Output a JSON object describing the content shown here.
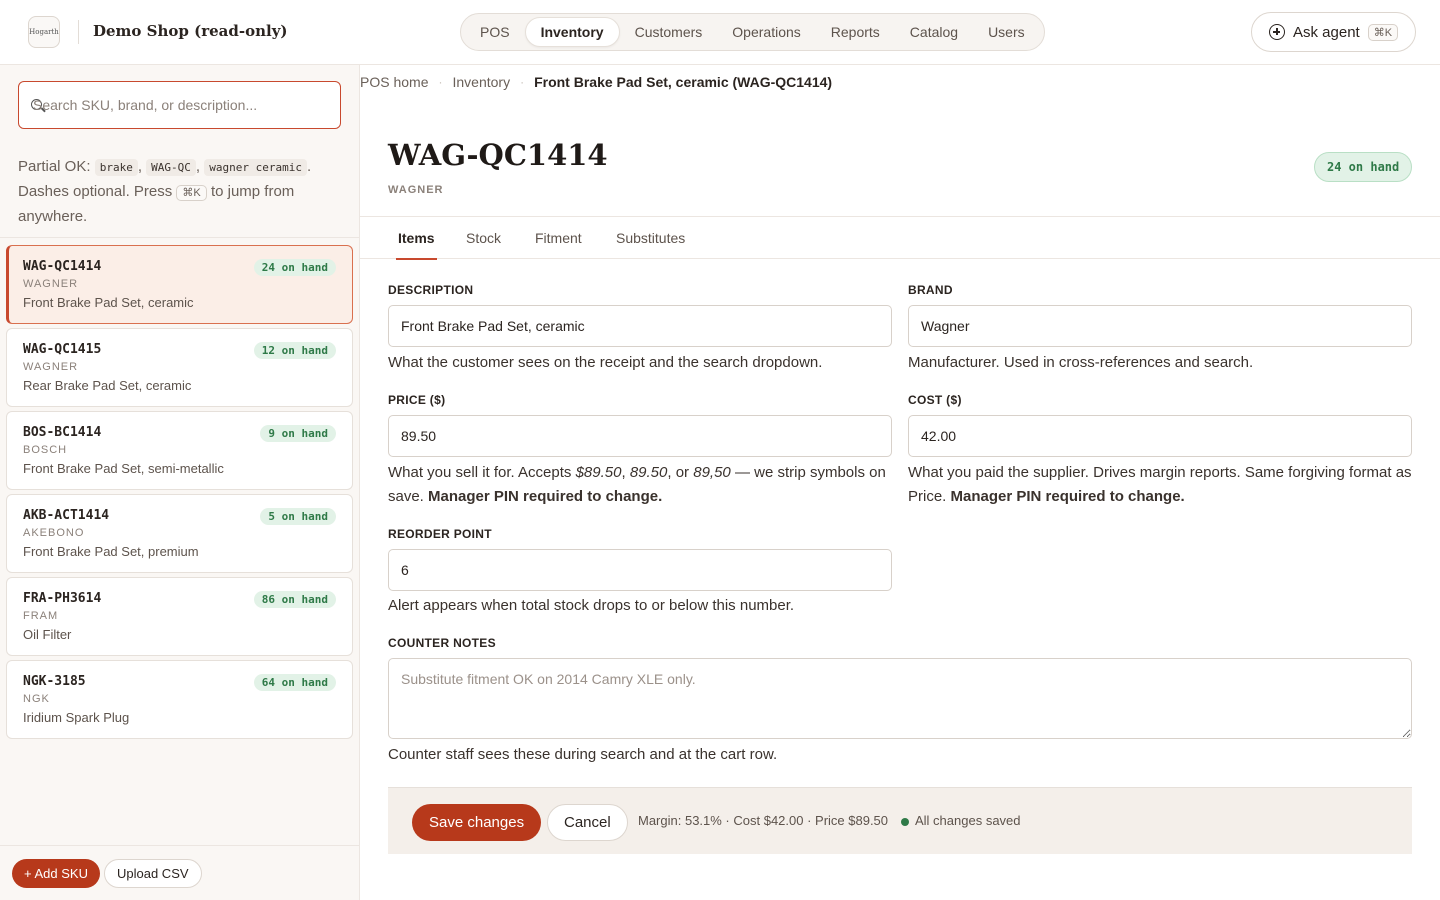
{
  "header": {
    "logo_text": "Hogarth",
    "shop_name": "Demo Shop (read-only)",
    "nav": [
      {
        "label": "POS"
      },
      {
        "label": "Inventory"
      },
      {
        "label": "Customers"
      },
      {
        "label": "Operations"
      },
      {
        "label": "Reports"
      },
      {
        "label": "Catalog"
      },
      {
        "label": "Users"
      }
    ],
    "active_nav": "Inventory",
    "ask_agent_label": "Ask agent",
    "ask_agent_shortcut": "⌘K"
  },
  "sidebar": {
    "search_placeholder": "Search SKU, brand, or description...",
    "hint": {
      "prefix": "Partial OK:",
      "examples": [
        "brake",
        "WAG-QC",
        "wagner ceramic"
      ],
      "middle": "Dashes optional. Press",
      "shortcut": "⌘K",
      "suffix": "to jump from anywhere."
    },
    "items": [
      {
        "code": "WAG-QC1414",
        "brand": "WAGNER",
        "description": "Front Brake Pad Set, ceramic",
        "stock": "24 on hand"
      },
      {
        "code": "WAG-QC1415",
        "brand": "WAGNER",
        "description": "Rear Brake Pad Set, ceramic",
        "stock": "12 on hand"
      },
      {
        "code": "BOS-BC1414",
        "brand": "BOSCH",
        "description": "Front Brake Pad Set, semi-metallic",
        "stock": "9 on hand"
      },
      {
        "code": "AKB-ACT1414",
        "brand": "AKEBONO",
        "description": "Front Brake Pad Set, premium",
        "stock": "5 on hand"
      },
      {
        "code": "FRA-PH3614",
        "brand": "FRAM",
        "description": "Oil Filter",
        "stock": "86 on hand"
      },
      {
        "code": "NGK-3185",
        "brand": "NGK",
        "description": "Iridium Spark Plug",
        "stock": "64 on hand"
      }
    ],
    "add_sku_label": "+ Add SKU",
    "upload_csv_label": "Upload CSV"
  },
  "breadcrumb": {
    "items": [
      "POS home",
      "Inventory"
    ],
    "current": "Front Brake Pad Set, ceramic (WAG-QC1414)"
  },
  "product": {
    "code": "WAG-QC1414",
    "brand": "WAGNER",
    "stock_badge": "24 on hand"
  },
  "tabs": [
    {
      "label": "Items"
    },
    {
      "label": "Stock"
    },
    {
      "label": "Fitment"
    },
    {
      "label": "Substitutes"
    }
  ],
  "active_tab": "Items",
  "form": {
    "description": {
      "label": "DESCRIPTION",
      "value": "Front Brake Pad Set, ceramic",
      "help": "What the customer sees on the receipt and the search dropdown."
    },
    "brand": {
      "label": "BRAND",
      "value": "Wagner",
      "help": "Manufacturer. Used in cross-references and search."
    },
    "price": {
      "label": "PRICE ($)",
      "value": "89.50",
      "help_prefix": "What you sell it for. Accepts",
      "help_examples": [
        "$89.50",
        "89.50",
        "89,50"
      ],
      "help_or": "or",
      "help_suffix": "— we strip symbols on save.",
      "help_bold": "Manager PIN required to change."
    },
    "cost": {
      "label": "COST ($)",
      "value": "42.00",
      "help": "What you paid the supplier. Drives margin reports. Same forgiving format as Price.",
      "help_bold": "Manager PIN required to change."
    },
    "reorder_point": {
      "label": "REORDER POINT",
      "value": "6",
      "help": "Alert appears when total stock drops to or below this number."
    },
    "counter_notes": {
      "label": "COUNTER NOTES",
      "value": "",
      "placeholder": "Substitute fitment OK on 2014 Camry XLE only.",
      "help": "Counter staff sees these during search and at the cart row."
    }
  },
  "actions": {
    "save_label": "Save changes",
    "cancel_label": "Cancel",
    "margin_summary": "Margin: 53.1% · Cost $42.00 · Price $89.50",
    "save_status": "All changes saved"
  },
  "colors": {
    "accent": "#b7391b",
    "success": "#2f7a48",
    "success_bg": "#e2f2e7"
  }
}
